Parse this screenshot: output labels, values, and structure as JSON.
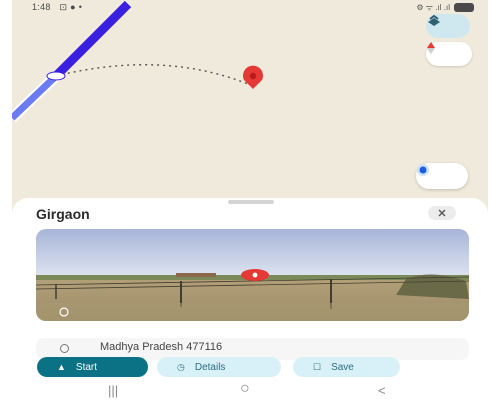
{
  "status_bar": {
    "time": "1:48",
    "icons_left": "⊡ ● •",
    "icons_right": "⚙ ᯤ .ıl .ıl"
  },
  "map": {
    "icons": [
      "layers-icon",
      "compass-icon",
      "my-location-icon",
      "place-pin-icon"
    ],
    "colors": {
      "land": "#efeadb",
      "route": "#3a1fe0",
      "pin": "#e53935"
    }
  },
  "sheet": {
    "title": "Girgaon",
    "close_icon": "close-icon",
    "address": "Madhya Pradesh 477116",
    "actions": [
      {
        "label": "Start",
        "icon": "navigation-arrow-icon"
      },
      {
        "label": "Details",
        "icon": "clock-icon"
      },
      {
        "label": "Save",
        "icon": "bookmark-icon"
      }
    ]
  },
  "navbar": {
    "recent": "|||",
    "home": "○",
    "back": "<"
  }
}
